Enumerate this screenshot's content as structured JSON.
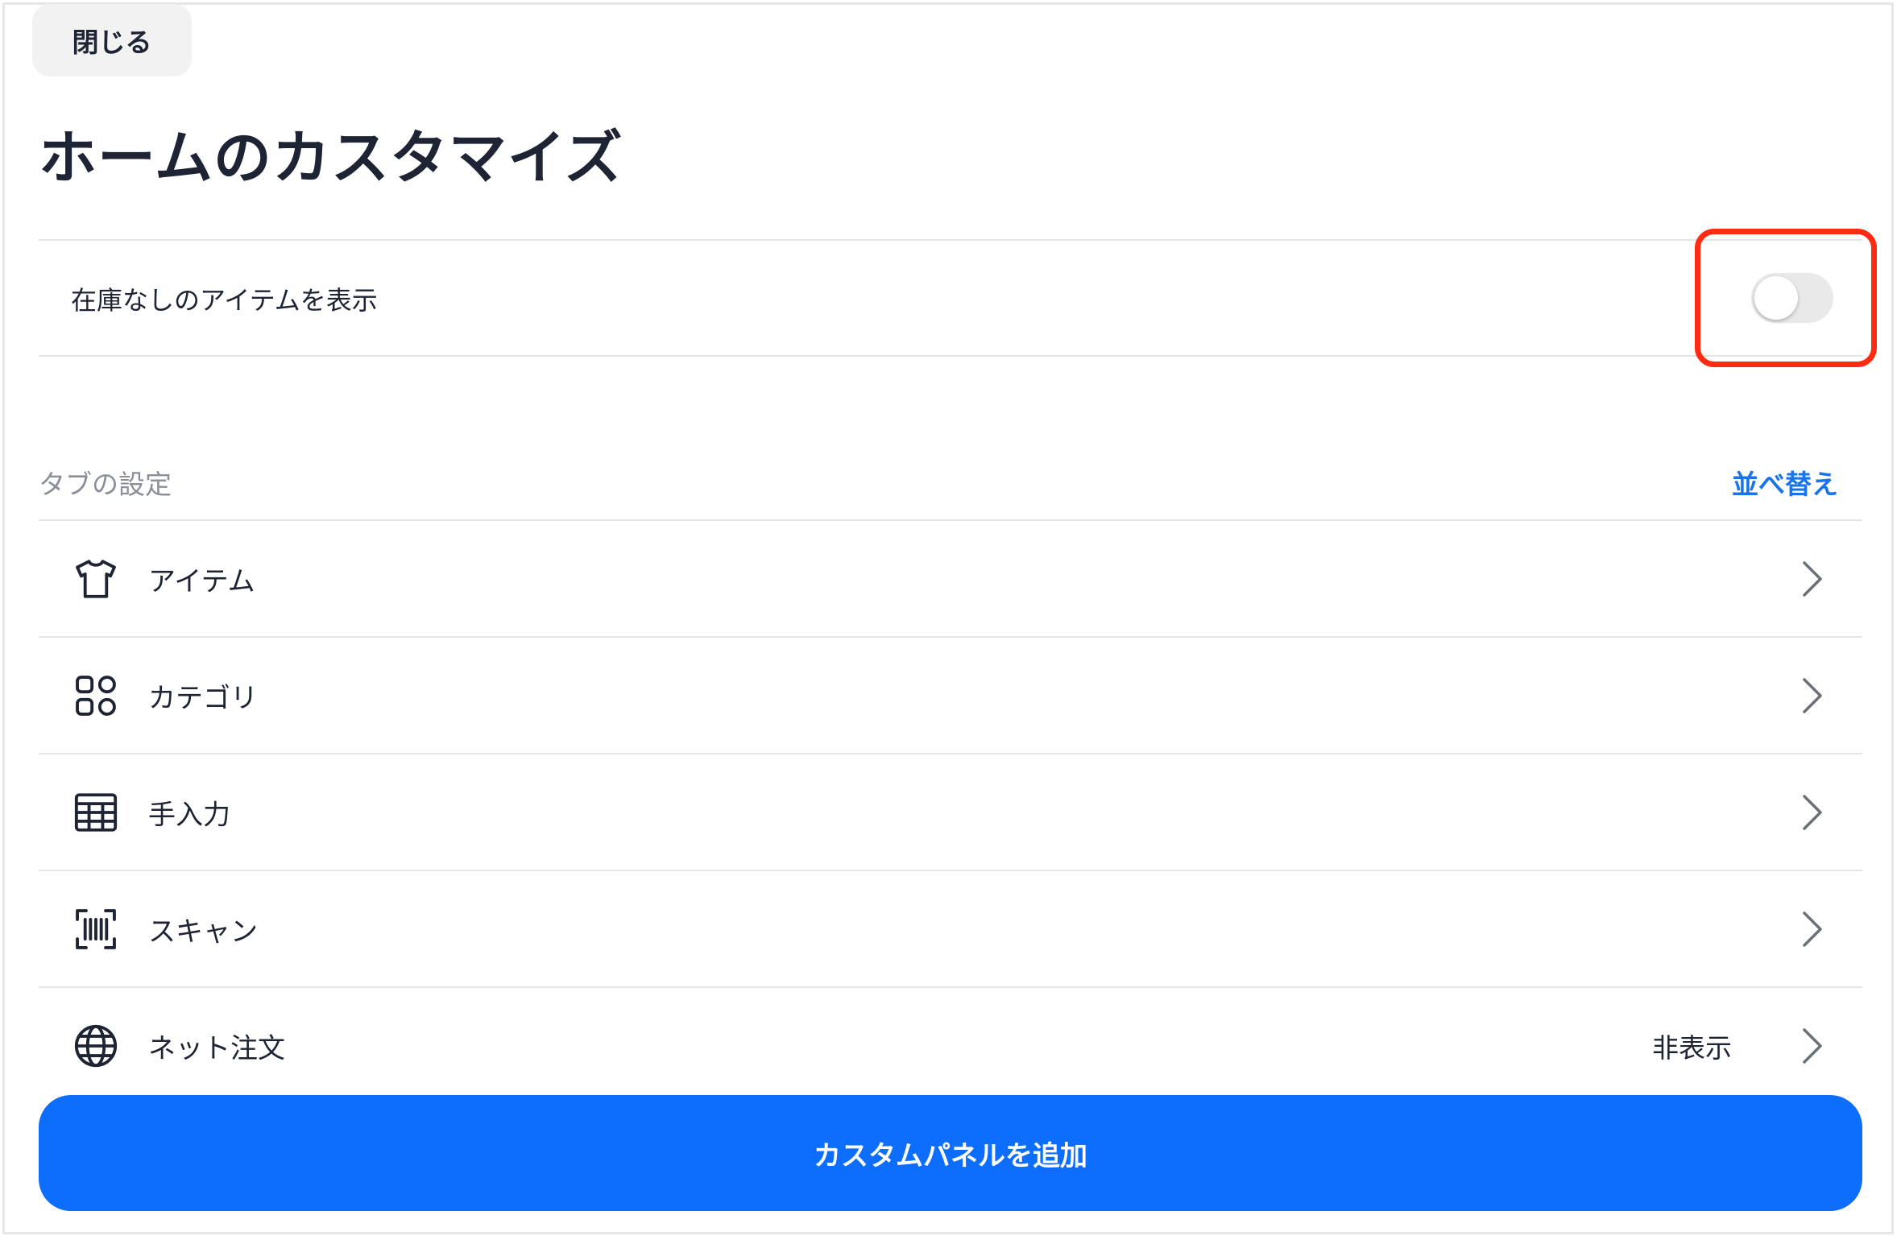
{
  "header": {
    "close_label": "閉じる",
    "title": "ホームのカスタマイズ"
  },
  "settings": {
    "show_out_of_stock_label": "在庫なしのアイテムを表示",
    "show_out_of_stock_enabled": false
  },
  "tabs_section": {
    "title": "タブの設定",
    "reorder_label": "並べ替え",
    "items": [
      {
        "label": "アイテム",
        "icon": "tshirt-icon",
        "status": ""
      },
      {
        "label": "カテゴリ",
        "icon": "category-grid-icon",
        "status": ""
      },
      {
        "label": "手入力",
        "icon": "keypad-icon",
        "status": ""
      },
      {
        "label": "スキャン",
        "icon": "barcode-scan-icon",
        "status": ""
      },
      {
        "label": "ネット注文",
        "icon": "globe-icon",
        "status": "非表示"
      }
    ]
  },
  "footer": {
    "add_panel_label": "カスタムパネルを追加"
  },
  "colors": {
    "accent": "#0d6efd",
    "link": "#1a73e8",
    "highlight": "#ff2b12",
    "toggle_off": "#e9e9ea"
  }
}
